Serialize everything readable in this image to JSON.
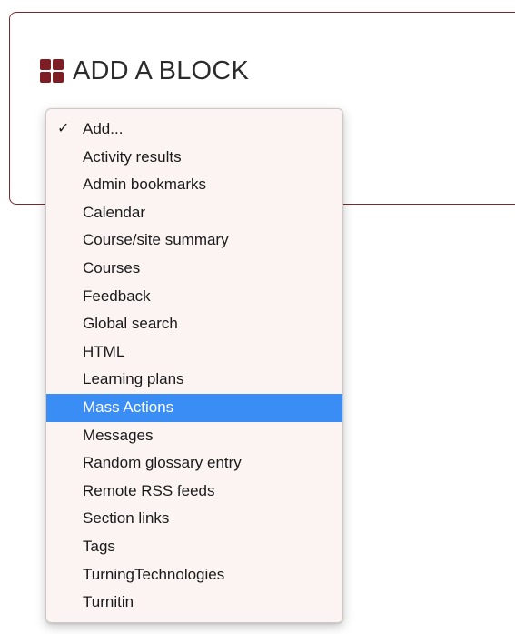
{
  "block": {
    "title": "ADD A BLOCK",
    "icon": "blocks-grid-icon",
    "accent_color": "#7f1d24"
  },
  "dropdown": {
    "selected_value": "Add...",
    "highlight_color": "#3a8df5",
    "options": [
      {
        "label": "Add...",
        "checked": true,
        "highlighted": false
      },
      {
        "label": "Activity results",
        "checked": false,
        "highlighted": false
      },
      {
        "label": "Admin bookmarks",
        "checked": false,
        "highlighted": false
      },
      {
        "label": "Calendar",
        "checked": false,
        "highlighted": false
      },
      {
        "label": "Course/site summary",
        "checked": false,
        "highlighted": false
      },
      {
        "label": "Courses",
        "checked": false,
        "highlighted": false
      },
      {
        "label": "Feedback",
        "checked": false,
        "highlighted": false
      },
      {
        "label": "Global search",
        "checked": false,
        "highlighted": false
      },
      {
        "label": "HTML",
        "checked": false,
        "highlighted": false
      },
      {
        "label": "Learning plans",
        "checked": false,
        "highlighted": false
      },
      {
        "label": "Mass Actions",
        "checked": false,
        "highlighted": true
      },
      {
        "label": "Messages",
        "checked": false,
        "highlighted": false
      },
      {
        "label": "Random glossary entry",
        "checked": false,
        "highlighted": false
      },
      {
        "label": "Remote RSS feeds",
        "checked": false,
        "highlighted": false
      },
      {
        "label": "Section links",
        "checked": false,
        "highlighted": false
      },
      {
        "label": "Tags",
        "checked": false,
        "highlighted": false
      },
      {
        "label": "TurningTechnologies",
        "checked": false,
        "highlighted": false
      },
      {
        "label": "Turnitin",
        "checked": false,
        "highlighted": false
      }
    ]
  }
}
